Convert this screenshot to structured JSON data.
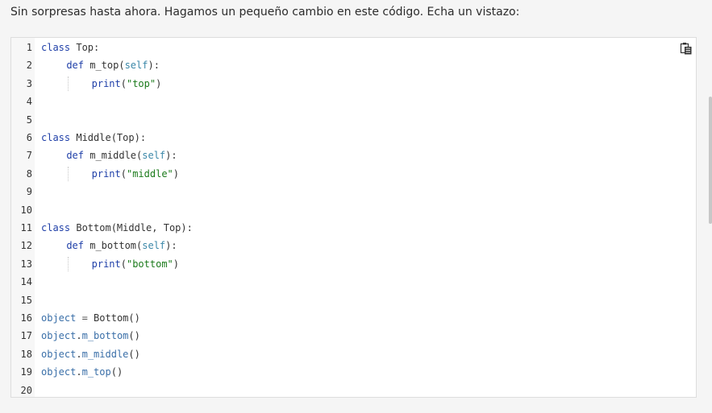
{
  "intro_text": "Sin sorpresas hasta ahora. Hagamos un pequeño cambio en este código. Echa un vistazo:",
  "code": {
    "line_numbers": [
      "1",
      "2",
      "3",
      "4",
      "5",
      "6",
      "7",
      "8",
      "9",
      "10",
      "11",
      "12",
      "13",
      "14",
      "15",
      "16",
      "17",
      "18",
      "19",
      "20"
    ],
    "lines": [
      {
        "indent": 0,
        "tokens": [
          {
            "t": "kw",
            "v": "class"
          },
          {
            "t": "plain",
            "v": " Top:"
          }
        ]
      },
      {
        "indent": 1,
        "tokens": [
          {
            "t": "kw",
            "v": "def"
          },
          {
            "t": "plain",
            "v": " m_top("
          },
          {
            "t": "self",
            "v": "self"
          },
          {
            "t": "plain",
            "v": "):"
          }
        ]
      },
      {
        "indent": 2,
        "tokens": [
          {
            "t": "builtin",
            "v": "print"
          },
          {
            "t": "plain",
            "v": "("
          },
          {
            "t": "str",
            "v": "\"top\""
          },
          {
            "t": "plain",
            "v": ")"
          }
        ]
      },
      {
        "indent": 0,
        "tokens": []
      },
      {
        "indent": 0,
        "tokens": []
      },
      {
        "indent": 0,
        "tokens": [
          {
            "t": "kw",
            "v": "class"
          },
          {
            "t": "plain",
            "v": " Middle(Top):"
          }
        ]
      },
      {
        "indent": 1,
        "tokens": [
          {
            "t": "kw",
            "v": "def"
          },
          {
            "t": "plain",
            "v": " m_middle("
          },
          {
            "t": "self",
            "v": "self"
          },
          {
            "t": "plain",
            "v": "):"
          }
        ]
      },
      {
        "indent": 2,
        "tokens": [
          {
            "t": "builtin",
            "v": "print"
          },
          {
            "t": "plain",
            "v": "("
          },
          {
            "t": "str",
            "v": "\"middle\""
          },
          {
            "t": "plain",
            "v": ")"
          }
        ]
      },
      {
        "indent": 0,
        "tokens": []
      },
      {
        "indent": 0,
        "tokens": []
      },
      {
        "indent": 0,
        "tokens": [
          {
            "t": "kw",
            "v": "class"
          },
          {
            "t": "plain",
            "v": " Bottom(Middle, Top):"
          }
        ]
      },
      {
        "indent": 1,
        "tokens": [
          {
            "t": "kw",
            "v": "def"
          },
          {
            "t": "plain",
            "v": " m_bottom("
          },
          {
            "t": "self",
            "v": "self"
          },
          {
            "t": "plain",
            "v": "):"
          }
        ]
      },
      {
        "indent": 2,
        "tokens": [
          {
            "t": "builtin",
            "v": "print"
          },
          {
            "t": "plain",
            "v": "("
          },
          {
            "t": "str",
            "v": "\"bottom\""
          },
          {
            "t": "plain",
            "v": ")"
          }
        ]
      },
      {
        "indent": 0,
        "tokens": []
      },
      {
        "indent": 0,
        "tokens": []
      },
      {
        "indent": 0,
        "tokens": [
          {
            "t": "var",
            "v": "object"
          },
          {
            "t": "op",
            "v": " = "
          },
          {
            "t": "plain",
            "v": "Bottom()"
          }
        ]
      },
      {
        "indent": 0,
        "tokens": [
          {
            "t": "var",
            "v": "object"
          },
          {
            "t": "plain",
            "v": "."
          },
          {
            "t": "var",
            "v": "m_bottom"
          },
          {
            "t": "plain",
            "v": "()"
          }
        ]
      },
      {
        "indent": 0,
        "tokens": [
          {
            "t": "var",
            "v": "object"
          },
          {
            "t": "plain",
            "v": "."
          },
          {
            "t": "var",
            "v": "m_middle"
          },
          {
            "t": "plain",
            "v": "()"
          }
        ]
      },
      {
        "indent": 0,
        "tokens": [
          {
            "t": "var",
            "v": "object"
          },
          {
            "t": "plain",
            "v": "."
          },
          {
            "t": "var",
            "v": "m_top"
          },
          {
            "t": "plain",
            "v": "()"
          }
        ]
      },
      {
        "indent": 0,
        "tokens": []
      }
    ]
  },
  "copy_button": {
    "icon": "copy-icon"
  },
  "colors": {
    "keyword": "#1f3fa8",
    "string": "#1a7a1a",
    "self": "#3a87a8",
    "variable": "#3a6fa8"
  }
}
